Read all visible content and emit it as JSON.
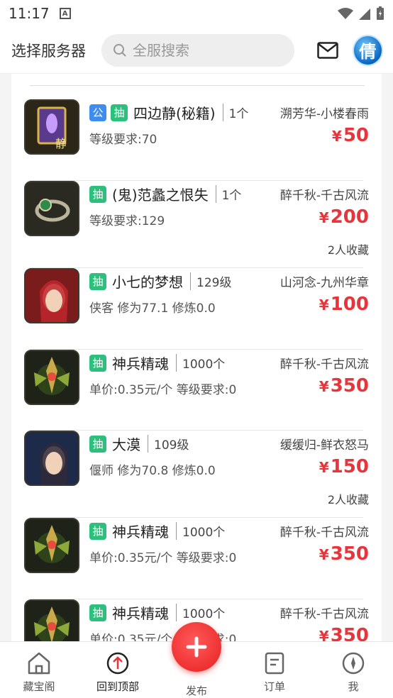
{
  "status": {
    "time": "11:17",
    "a_icon": "A"
  },
  "header": {
    "server_select": "选择服务器",
    "search_placeholder": "全服搜索",
    "avatar_text": "倩"
  },
  "items": [
    {
      "tags": [
        "公",
        "抽"
      ],
      "tag_colors": [
        "#3d8cf0",
        "#2dc07c"
      ],
      "name": "四边静(秘籍)",
      "qty": "1个",
      "detail": "等级要求:70",
      "seller": "溯芳华-小楼春雨",
      "currency": "¥",
      "price": "50",
      "fav": "",
      "thumb": "book-icon"
    },
    {
      "tags": [
        "抽"
      ],
      "tag_colors": [
        "#2dc07c"
      ],
      "name": "(鬼)范蠡之恨失",
      "qty": "1个",
      "detail": "等级要求:129",
      "seller": "醉千秋-千古风流",
      "currency": "¥",
      "price": "200",
      "fav": "2人收藏",
      "thumb": "ring-icon"
    },
    {
      "tags": [
        "抽"
      ],
      "tag_colors": [
        "#2dc07c"
      ],
      "name": "小七的梦想",
      "qty": "129级",
      "detail": "侠客 修为77.1 修炼0.0",
      "seller": "山河念-九州华章",
      "currency": "¥",
      "price": "100",
      "fav": "",
      "thumb": "character-portrait"
    },
    {
      "tags": [
        "抽"
      ],
      "tag_colors": [
        "#2dc07c"
      ],
      "name": "神兵精魂",
      "qty": "1000个",
      "detail": "单价:0.35元/个 等级要求:0",
      "seller": "醉千秋-千古风流",
      "currency": "¥",
      "price": "350",
      "fav": "",
      "thumb": "soul-icon"
    },
    {
      "tags": [
        "抽"
      ],
      "tag_colors": [
        "#2dc07c"
      ],
      "name": "大漠",
      "qty": "109级",
      "detail": "偃师 修为70.8 修炼0.0",
      "seller": "缓缓归-鲜衣怒马",
      "currency": "¥",
      "price": "150",
      "fav": "2人收藏",
      "thumb": "character-portrait"
    },
    {
      "tags": [
        "抽"
      ],
      "tag_colors": [
        "#2dc07c"
      ],
      "name": "神兵精魂",
      "qty": "1000个",
      "detail": "单价:0.35元/个 等级要求:0",
      "seller": "醉千秋-千古风流",
      "currency": "¥",
      "price": "350",
      "fav": "",
      "thumb": "soul-icon"
    },
    {
      "tags": [
        "抽"
      ],
      "tag_colors": [
        "#2dc07c"
      ],
      "name": "神兵精魂",
      "qty": "1000个",
      "detail": "单价:0.35元/个 等级要求:0",
      "seller": "醉千秋-千古风流",
      "currency": "¥",
      "price": "350",
      "fav": "",
      "thumb": "soul-icon"
    }
  ],
  "tabbar": {
    "home": "藏宝阁",
    "top": "回到顶部",
    "publish": "发布",
    "orders": "订单",
    "me": "我"
  },
  "colors": {
    "price": "#e8343a",
    "publish": "#e81e1e",
    "tag_green": "#2dc07c",
    "tag_blue": "#3d8cf0"
  }
}
